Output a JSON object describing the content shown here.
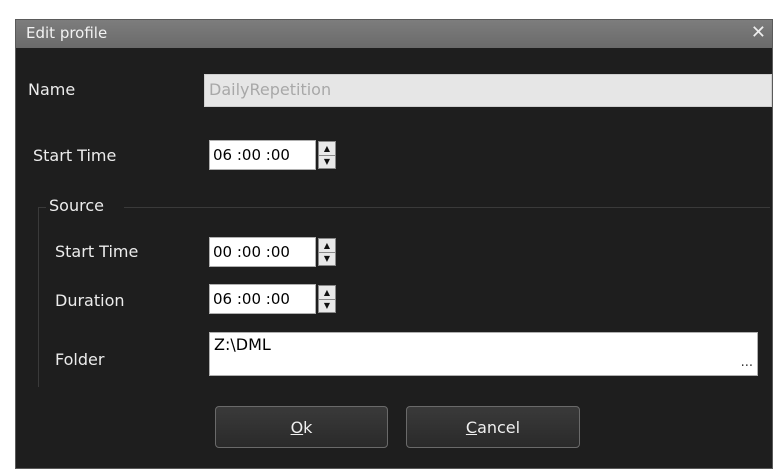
{
  "dialog": {
    "title": "Edit profile",
    "close_glyph": "✕"
  },
  "fields": {
    "name_label": "Name",
    "name_value": "DailyRepetition",
    "start_time_label": "Start Time",
    "start_time_value": "06 :00 :00"
  },
  "source": {
    "group_label": "Source",
    "start_time_label": "Start Time",
    "start_time_value": "00 :00 :00",
    "duration_label": "Duration",
    "duration_value": "06 :00 :00",
    "folder_label": "Folder",
    "folder_value": "Z:\\DML",
    "browse_glyph": "..."
  },
  "buttons": {
    "ok_mnemonic": "O",
    "ok_rest": "k",
    "cancel_mnemonic": "C",
    "cancel_rest": "ancel"
  },
  "icons": {
    "spin_up": "▲",
    "spin_down": "▼"
  }
}
